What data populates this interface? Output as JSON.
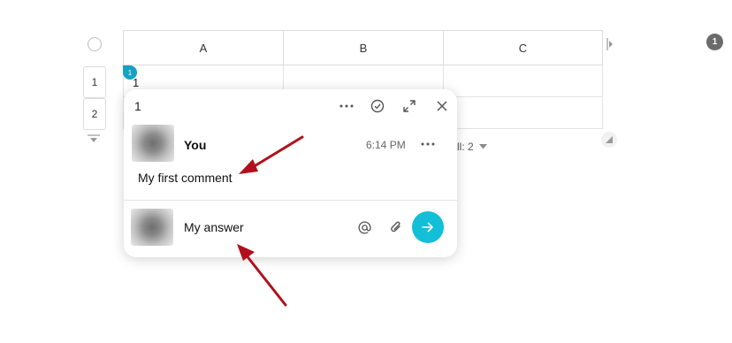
{
  "grid": {
    "columns": [
      "A",
      "B",
      "C"
    ],
    "rows": [
      "1",
      "2"
    ],
    "cell_a1": "1",
    "cell_marker": "1",
    "footer_summary": "All: 2"
  },
  "top_badge": "1",
  "comment_popup": {
    "title": "1",
    "comment": {
      "author": "You",
      "time": "6:14 PM",
      "text": "My first comment"
    },
    "reply": {
      "value": "My answer",
      "placeholder": "My answer"
    }
  },
  "colors": {
    "accent": "#13bfd8",
    "marker": "#16a2c4",
    "annotation_arrow": "#b0101b"
  },
  "icons": [
    "more-icon",
    "resolve-check-icon",
    "expand-icon",
    "close-icon",
    "mention-icon",
    "attach-icon",
    "send-arrow-icon"
  ]
}
